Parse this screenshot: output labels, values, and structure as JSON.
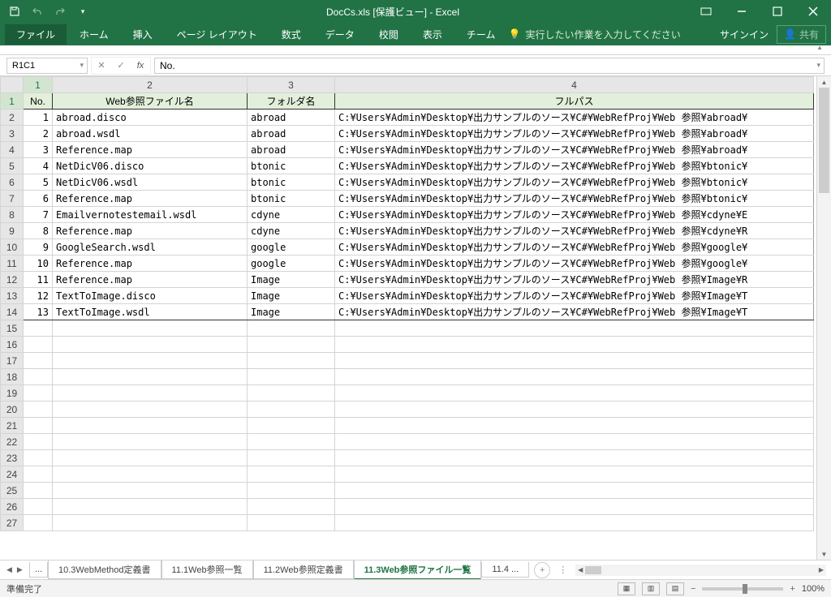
{
  "title": "DocCs.xls  [保護ビュー] - Excel",
  "ribbon": {
    "file": "ファイル",
    "home": "ホーム",
    "insert": "挿入",
    "pagelayout": "ページ レイアウト",
    "formulas": "数式",
    "data": "データ",
    "review": "校閲",
    "view": "表示",
    "team": "チーム",
    "tellme": "実行したい作業を入力してください",
    "signin": "サインイン",
    "share": "共有"
  },
  "namebox": "R1C1",
  "formula": "No.",
  "col_heads": [
    "1",
    "2",
    "3",
    "4"
  ],
  "headers": {
    "no": "No.",
    "fname": "Web参照ファイル名",
    "folder": "フォルダ名",
    "path": "フルパス"
  },
  "rows": [
    {
      "n": "1",
      "f": "abroad.disco",
      "d": "abroad",
      "p": "C:¥Users¥Admin¥Desktop¥出力サンプルのソース¥C#¥WebRefProj¥Web 参照¥abroad¥"
    },
    {
      "n": "2",
      "f": "abroad.wsdl",
      "d": "abroad",
      "p": "C:¥Users¥Admin¥Desktop¥出力サンプルのソース¥C#¥WebRefProj¥Web 参照¥abroad¥"
    },
    {
      "n": "3",
      "f": "Reference.map",
      "d": "abroad",
      "p": "C:¥Users¥Admin¥Desktop¥出力サンプルのソース¥C#¥WebRefProj¥Web 参照¥abroad¥"
    },
    {
      "n": "4",
      "f": "NetDicV06.disco",
      "d": "btonic",
      "p": "C:¥Users¥Admin¥Desktop¥出力サンプルのソース¥C#¥WebRefProj¥Web 参照¥btonic¥"
    },
    {
      "n": "5",
      "f": "NetDicV06.wsdl",
      "d": "btonic",
      "p": "C:¥Users¥Admin¥Desktop¥出力サンプルのソース¥C#¥WebRefProj¥Web 参照¥btonic¥"
    },
    {
      "n": "6",
      "f": "Reference.map",
      "d": "btonic",
      "p": "C:¥Users¥Admin¥Desktop¥出力サンプルのソース¥C#¥WebRefProj¥Web 参照¥btonic¥"
    },
    {
      "n": "7",
      "f": "Emailvernotestemail.wsdl",
      "d": "cdyne",
      "p": "C:¥Users¥Admin¥Desktop¥出力サンプルのソース¥C#¥WebRefProj¥Web 参照¥cdyne¥E"
    },
    {
      "n": "8",
      "f": "Reference.map",
      "d": "cdyne",
      "p": "C:¥Users¥Admin¥Desktop¥出力サンプルのソース¥C#¥WebRefProj¥Web 参照¥cdyne¥R"
    },
    {
      "n": "9",
      "f": "GoogleSearch.wsdl",
      "d": "google",
      "p": "C:¥Users¥Admin¥Desktop¥出力サンプルのソース¥C#¥WebRefProj¥Web 参照¥google¥"
    },
    {
      "n": "10",
      "f": "Reference.map",
      "d": "google",
      "p": "C:¥Users¥Admin¥Desktop¥出力サンプルのソース¥C#¥WebRefProj¥Web 参照¥google¥"
    },
    {
      "n": "11",
      "f": "Reference.map",
      "d": "Image",
      "p": "C:¥Users¥Admin¥Desktop¥出力サンプルのソース¥C#¥WebRefProj¥Web 参照¥Image¥R"
    },
    {
      "n": "12",
      "f": "TextToImage.disco",
      "d": "Image",
      "p": "C:¥Users¥Admin¥Desktop¥出力サンプルのソース¥C#¥WebRefProj¥Web 参照¥Image¥T"
    },
    {
      "n": "13",
      "f": "TextToImage.wsdl",
      "d": "Image",
      "p": "C:¥Users¥Admin¥Desktop¥出力サンプルのソース¥C#¥WebRefProj¥Web 参照¥Image¥T"
    }
  ],
  "blank_rows": [
    "15",
    "16",
    "17",
    "18",
    "19",
    "20",
    "21",
    "22",
    "23",
    "24",
    "25",
    "26",
    "27"
  ],
  "tabs": {
    "ellipsis": "...",
    "t1": "10.3WebMethod定義書",
    "t2": "11.1Web参照一覧",
    "t3": "11.2Web参照定義書",
    "t4": "11.3Web参照ファイル一覧",
    "t5": "11.4 ..."
  },
  "status": {
    "ready": "準備完了",
    "zoom": "100%"
  }
}
